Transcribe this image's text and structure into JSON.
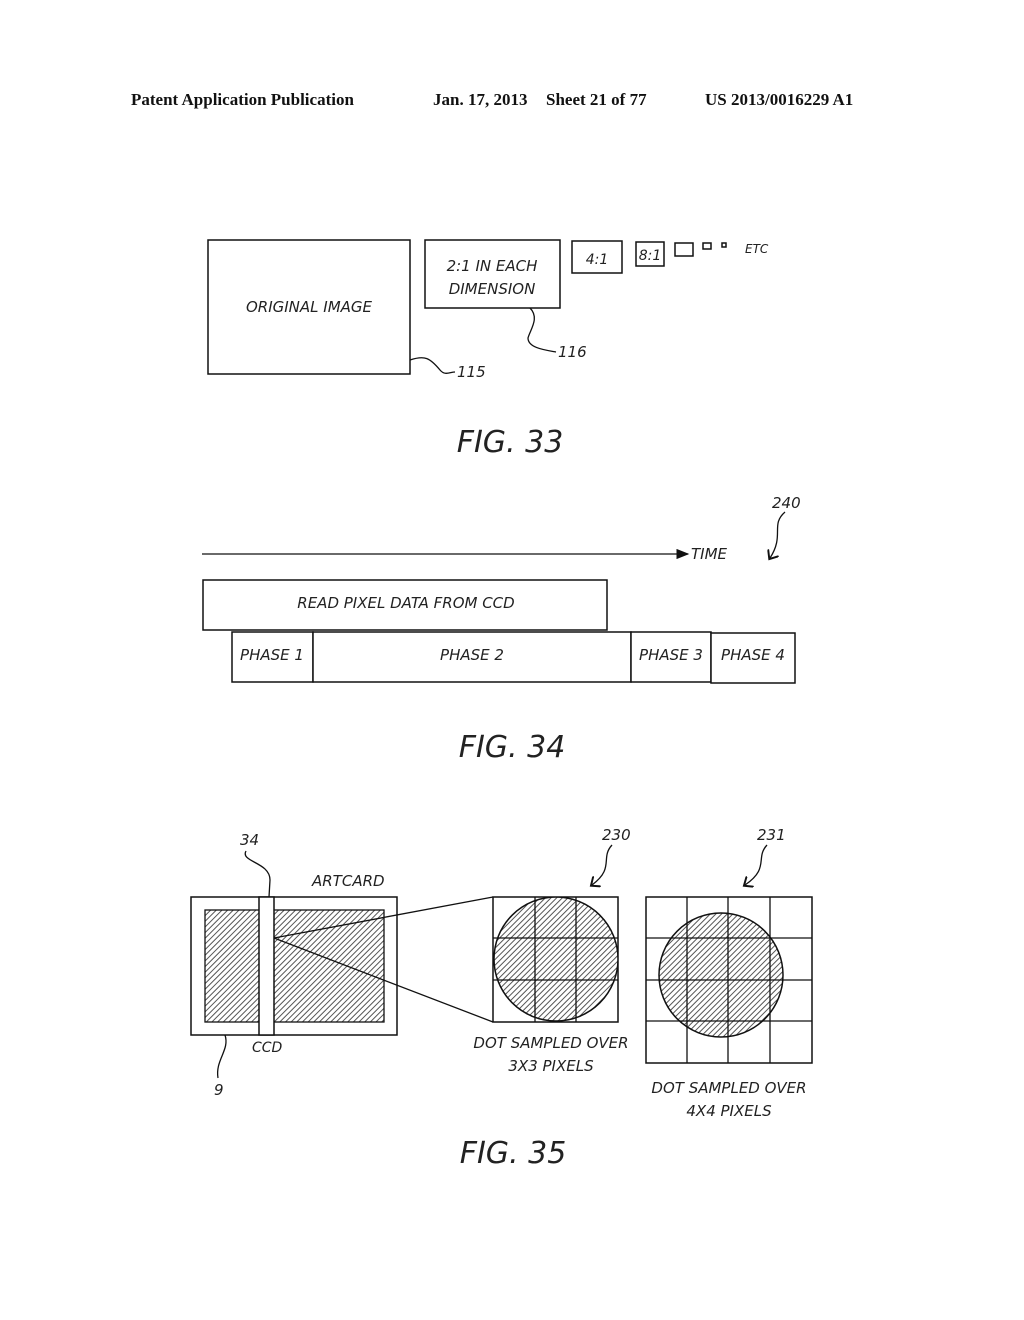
{
  "header": {
    "publication": "Patent Application Publication",
    "date": "Jan. 17, 2013",
    "sheet": "Sheet 21 of 77",
    "number": "US 2013/0016229 A1"
  },
  "fig33": {
    "caption": "FIG. 33",
    "original_label": "ORIGINAL IMAGE",
    "half_label_line1": "2:1 IN EACH",
    "half_label_line2": "DIMENSION",
    "quarter_label": "4:1",
    "eighth_label": "8:1",
    "etc_label": "ETC",
    "ref_original": "115",
    "ref_half": "116"
  },
  "fig34": {
    "caption": "FIG. 34",
    "time_label": "TIME",
    "ref": "240",
    "read_label": "READ PIXEL DATA FROM CCD",
    "phases": [
      "PHASE 1",
      "PHASE 2",
      "PHASE 3",
      "PHASE 4"
    ]
  },
  "fig35": {
    "caption": "FIG. 35",
    "artcard_label": "ARTCARD",
    "ccd_label": "CCD",
    "ref_ccd": "34",
    "ref_card": "9",
    "ref_3x3": "230",
    "ref_4x4": "231",
    "label_3x3_line1": "DOT SAMPLED OVER",
    "label_3x3_line2": "3X3 PIXELS",
    "label_4x4_line1": "DOT SAMPLED OVER",
    "label_4x4_line2": "4X4 PIXELS"
  }
}
